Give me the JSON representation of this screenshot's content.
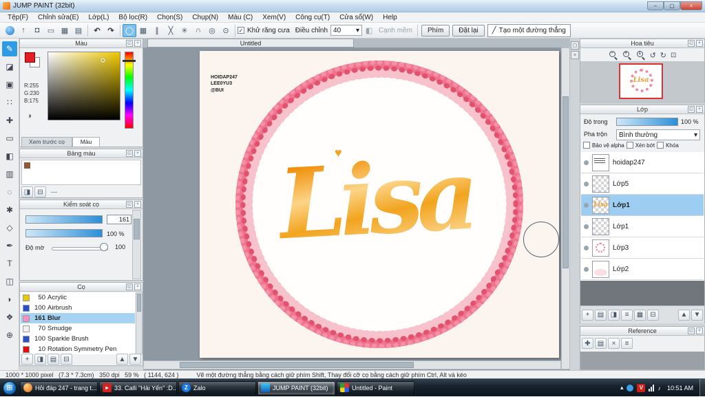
{
  "window": {
    "title": "JUMP PAINT (32bit)",
    "menu": [
      "Tệp(F)",
      "Chỉnh sửa(E)",
      "Lớp(L)",
      "Bộ lọc(R)",
      "Chọn(S)",
      "Chụp(N)",
      "Màu (C)",
      "Xem(V)",
      "Công cụ(T)",
      "Cửa sổ(W)",
      "Help"
    ]
  },
  "toolbar": {
    "antialias": "Khử răng cưa",
    "adjust_label": "Điều chỉnh",
    "adjust_value": "40",
    "soft_edge": "Cạnh mềm",
    "key_btn": "Phím",
    "reset_btn": "Đặt lại",
    "line_tool": "Tạo một đường thẳng"
  },
  "panels": {
    "color": {
      "title": "Màu",
      "r": "R:255",
      "g": "G:230",
      "b": "B:175",
      "tab_preview": "Xem trước cọ",
      "tab_color": "Màu"
    },
    "palette": {
      "title": "Bảng màu",
      "empty": "---"
    },
    "brush_control": {
      "title": "Kiểm soát cọ",
      "size": "161",
      "opacity": "100 %",
      "blur_label": "Độ mờ",
      "blur_value": "100"
    },
    "brushes": {
      "title": "Cọ",
      "items": [
        {
          "size": "50",
          "name": "Acrylic",
          "color": "#e6c800"
        },
        {
          "size": "100",
          "name": "Airbrush",
          "color": "#2a50c8"
        },
        {
          "size": "161",
          "name": "Blur",
          "color": "#f490c0"
        },
        {
          "size": "70",
          "name": "Smudge",
          "color": "#f0f0f0"
        },
        {
          "size": "100",
          "name": "Sparkle Brush",
          "color": "#2a50c8"
        },
        {
          "size": "10",
          "name": "Rotation Symmetry Pen",
          "color": "#e01010"
        }
      ]
    },
    "navigator": {
      "title": "Hoa tiêu"
    },
    "layers": {
      "title": "Lớp",
      "opacity_label": "Độ trong",
      "opacity_value": "100 %",
      "blend_label": "Pha trộn",
      "blend_value": "Bình thường",
      "protect_alpha": "Bảo vệ alpha",
      "clipping": "Xén bớt",
      "lock": "Khóa",
      "items": [
        {
          "name": "hoidap247"
        },
        {
          "name": "Lớp5"
        },
        {
          "name": "Lớp1"
        },
        {
          "name": "Lớp1"
        },
        {
          "name": "Lớp3"
        },
        {
          "name": "Lớp2"
        }
      ]
    },
    "reference": {
      "title": "Reference"
    }
  },
  "canvas": {
    "tab": "Untitled",
    "watermark": [
      "HOIDAP247",
      "LEE0YU3",
      "@BUI"
    ],
    "artwork_text": "Lisa",
    "heart": "♥"
  },
  "status": {
    "info": "1000 * 1000 pixel   (7.3 * 7.3cm)   350 dpi   59 %   ( 1144, 624 )",
    "hint": "Vẽ một đường thẳng bằng cách giữ phím Shift, Thay đổi cỡ cọ bằng cách giữ phím Ctrl, Alt và kéo"
  },
  "taskbar": {
    "buttons": [
      {
        "label": "Hỏi đáp 247 - trang t..."
      },
      {
        "label": "33. Calli \"Hải Yến\" :D..."
      },
      {
        "label": "Zalo"
      },
      {
        "label": "JUMP PAINT (32bit)"
      },
      {
        "label": "Untitled - Paint"
      }
    ],
    "zalo_initial": "Z",
    "unikey": "V",
    "time": "10:51 AM"
  },
  "icons": {
    "minimize": "–",
    "maximize": "▢",
    "close": "×",
    "panel_float": "◱",
    "panel_close": "×",
    "upload": "↑",
    "chat": "◘",
    "monitor": "▭",
    "material": "▦",
    "layout": "▤",
    "undo": "↶",
    "redo": "↷",
    "snap_circle": "◯",
    "snap_grid": "▦",
    "snap_parallel": "∥",
    "snap_cross": "╳",
    "snap_radial": "✳",
    "snap_curve": "∩",
    "snap_concentric": "◎",
    "snap_vanish": "⊙",
    "check": "✓",
    "dropdown": "▾",
    "soft_edge": "◧",
    "pencil": "╱",
    "tool_brush": "✎",
    "tool_eraser": "◪",
    "tool_stamp": "▣",
    "tool_dot": "∷",
    "tool_move": "✚",
    "tool_select": "▭",
    "tool_fill": "◧",
    "tool_gradient": "▥",
    "tool_lasso": "◌",
    "tool_wand": "✱",
    "tool_shape": "◇",
    "tool_pen": "✒",
    "tool_text": "T",
    "tool_divide": "◫",
    "tool_eyedrop": "◗",
    "tool_hand": "❖",
    "tool_zoom": "⊕",
    "zoom_out": "−",
    "zoom_in": "+",
    "zoom_one": "1",
    "rotate_left": "↺",
    "rotate_right": "↻",
    "fit": "⊡",
    "new": "+",
    "duplicate": "◨",
    "folder": "▤",
    "menu": "≡",
    "grid_sm": "▦",
    "trash": "⊟",
    "transparent": "◑",
    "arrow_up_sm": "▲",
    "arrow_down_sm": "▼",
    "chevron_up": "▴",
    "windows": "⊞",
    "speaker": "♪"
  }
}
